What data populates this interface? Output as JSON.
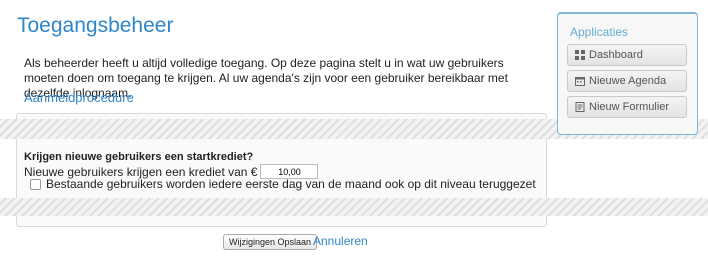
{
  "page": {
    "title": "Toegangsbeheer",
    "intro": "Als beheerder heeft u altijd volledige toegang. Op deze pagina stelt u in wat uw gebruikers moeten doen om toegang te krijgen. Al uw agenda's zijn voor een gebruiker bereikbaar met dezelfde inlognaam.",
    "login_link": "Aanmeldprocedure"
  },
  "credit": {
    "question": "Krijgen nieuwe gebruikers een startkrediet?",
    "label": "Nieuwe gebruikers krijgen een krediet van €",
    "value": "10,00",
    "checkbox_label": "Bestaande gebruikers worden iedere eerste dag van de maand ook op dit niveau teruggezet",
    "checkbox_checked": false
  },
  "actions": {
    "save_label": "Wijzigingen Opslaan",
    "cancel_label": "Annuleren"
  },
  "sidebar": {
    "title": "Applicaties",
    "items": [
      {
        "label": "Dashboard",
        "icon": "dashboard-icon"
      },
      {
        "label": "Nieuwe Agenda",
        "icon": "calendar-icon"
      },
      {
        "label": "Nieuw Formulier",
        "icon": "form-icon"
      }
    ]
  },
  "colors": {
    "accent": "#2f86c8",
    "sidebar_border": "#7fb8d4"
  }
}
